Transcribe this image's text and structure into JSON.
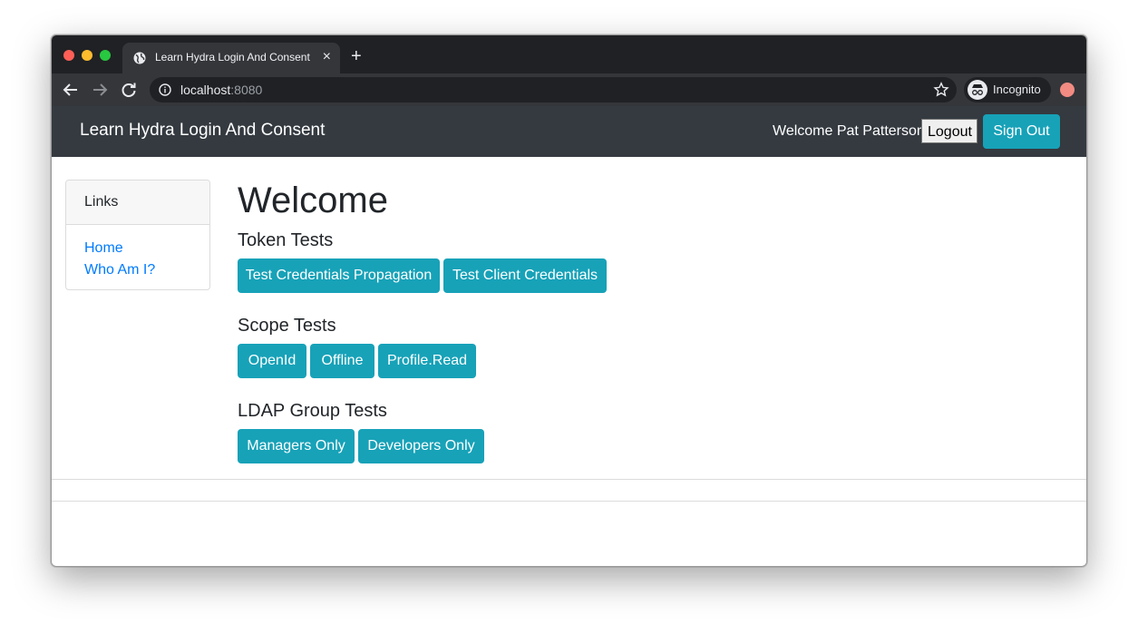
{
  "browser": {
    "tab_title": "Learn Hydra Login And Consent",
    "tab_close": "×",
    "new_tab": "+",
    "url_host": "localhost",
    "url_port": ":8080",
    "profile_label": "Incognito"
  },
  "navbar": {
    "brand": "Learn Hydra Login And Consent",
    "welcome_text": "Welcome Pat Patterson",
    "logout_label": "Logout",
    "signout_label": "Sign Out",
    "background": "#343a40"
  },
  "sidebar": {
    "header": "Links",
    "items": [
      {
        "label": "Home"
      },
      {
        "label": "Who Am I?"
      }
    ]
  },
  "main": {
    "title": "Welcome",
    "sections": [
      {
        "heading": "Token Tests",
        "buttons": [
          "Test Credentials Propagation",
          "Test Client Credentials"
        ]
      },
      {
        "heading": "Scope Tests",
        "buttons": [
          "OpenId",
          "Offline",
          "Profile.Read"
        ]
      },
      {
        "heading": "LDAP Group Tests",
        "buttons": [
          "Managers Only",
          "Developers Only"
        ]
      }
    ]
  },
  "colors": {
    "accent": "#17a2b8",
    "link": "#007bff"
  }
}
